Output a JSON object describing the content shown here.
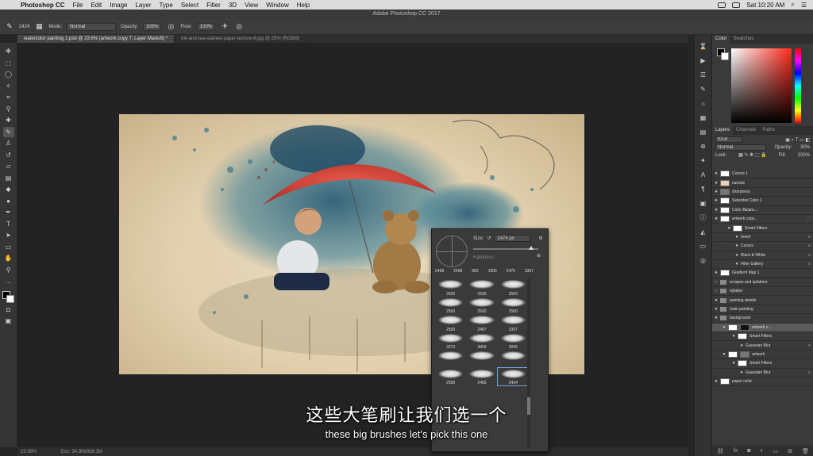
{
  "menubar": {
    "apple": "",
    "app": "Photoshop CC",
    "items": [
      "File",
      "Edit",
      "Image",
      "Layer",
      "Type",
      "Select",
      "Filter",
      "3D",
      "View",
      "Window",
      "Help"
    ],
    "clock": "Sat 10:20 AM"
  },
  "window": {
    "title": "Adobe Photoshop CC 2017"
  },
  "options": {
    "brush_size": "2424",
    "mode_label": "Mode:",
    "mode_value": "Normal",
    "opacity_label": "Opacity:",
    "opacity_value": "100%",
    "flow_label": "Flow:",
    "flow_value": "100%"
  },
  "tabs": [
    {
      "label": "watercolor painting 2.psd @ 23.6% (artwork copy 7, Layer Mask/8) *",
      "active": true
    },
    {
      "label": "ink-and-tea-stained-paper-texture-6.jpg @ 25% (RGB/8)",
      "active": false
    }
  ],
  "status": {
    "zoom": "23.59%",
    "doc": "Doc: 34.9M/856.3M"
  },
  "brush_popup": {
    "size_label": "Size:",
    "size_value": "2474 px",
    "hardness_label": "Hardness:",
    "top_row": [
      "2498",
      "2498",
      "950",
      "1900",
      "2476",
      "3397"
    ],
    "presets": [
      "2500",
      "2500",
      "2500",
      "2500",
      "2500",
      "2500",
      "2500",
      "2487",
      "3397",
      "3273",
      "3869",
      "2845",
      "",
      "",
      "",
      "2500",
      "2483",
      "2424"
    ]
  },
  "panels": {
    "color_tabs": [
      "Color",
      "Swatches"
    ],
    "layer_tabs": [
      "Layers",
      "Channels",
      "Paths"
    ],
    "kind_label": "Kind",
    "blend_mode": "Normal",
    "opacity_label": "Opacity:",
    "opacity_value": "30%",
    "lock_label": "Lock:",
    "fill_label": "Fill:",
    "fill_value": "100%",
    "layers": [
      {
        "name": "Curves 1",
        "type": "adj"
      },
      {
        "name": "canvas",
        "type": "skin"
      },
      {
        "name": "sharpness",
        "type": "grey"
      },
      {
        "name": "Selective Color 1",
        "type": "adj"
      },
      {
        "name": "Color Balanc...",
        "type": "adj"
      },
      {
        "name": "artwork copy...",
        "type": "mask"
      },
      {
        "name": "Smart Filters",
        "type": "sub"
      },
      {
        "name": "Invert",
        "type": "filter"
      },
      {
        "name": "Curves",
        "type": "filter"
      },
      {
        "name": "Black & White",
        "type": "filter"
      },
      {
        "name": "Filter Gallery",
        "type": "filter"
      },
      {
        "name": "Gradient Map 1",
        "type": "adj"
      },
      {
        "name": "scrapes and splatters",
        "type": "group"
      },
      {
        "name": "splatter",
        "type": "group"
      },
      {
        "name": "painting details",
        "type": "group"
      },
      {
        "name": "main painting",
        "type": "group"
      },
      {
        "name": "background",
        "type": "group"
      },
      {
        "name": "artwork c...",
        "type": "sel"
      },
      {
        "name": "Smart Filters",
        "type": "sub"
      },
      {
        "name": "Gaussian Blur",
        "type": "filter"
      },
      {
        "name": "artwork",
        "type": "mask"
      },
      {
        "name": "Smart Filters",
        "type": "sub"
      },
      {
        "name": "Gaussian Blur",
        "type": "filter"
      },
      {
        "name": "paper color",
        "type": "adj"
      }
    ]
  },
  "subtitles": {
    "zh": "这些大笔刷让我们选一个",
    "en": "these big brushes let's pick this one"
  }
}
